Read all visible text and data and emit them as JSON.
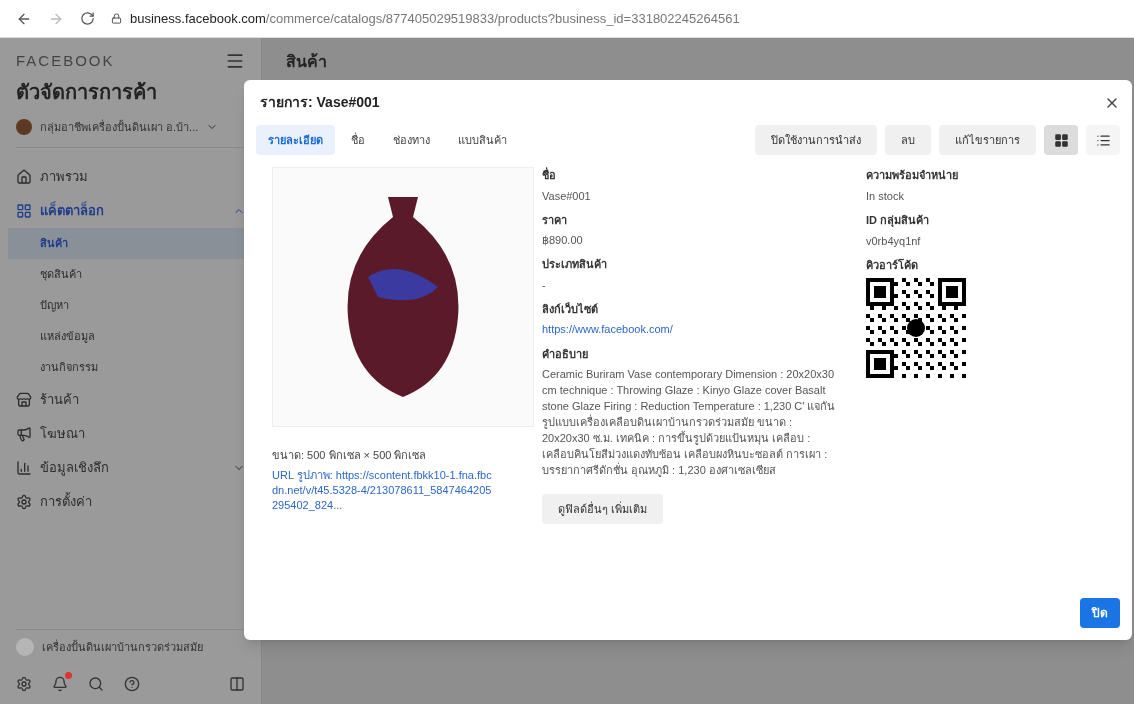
{
  "browser": {
    "url_domain": "business.facebook.com",
    "url_path": "/commerce/catalogs/877405029519833/products?business_id=331802245264561"
  },
  "sidebar": {
    "brand": "FACEBOOK",
    "title": "ตัวจัดการการค้า",
    "business": "กลุ่มอาชีพเครื่องปั้นดินเผา อ.บ้า...",
    "items": [
      {
        "kind": "home",
        "label": "ภาพรวม",
        "selected": false
      },
      {
        "kind": "catalog",
        "label": "แค็ตตาล็อก",
        "selected": true,
        "expanded": true,
        "children": [
          {
            "label": "สินค้า",
            "selected": true
          },
          {
            "label": "ชุดสินค้า",
            "selected": false
          },
          {
            "label": "ปัญหา",
            "selected": false
          },
          {
            "label": "แหล่งข้อมูล",
            "selected": false
          },
          {
            "label": "งานกิจกรรม",
            "selected": false
          }
        ]
      },
      {
        "kind": "shop",
        "label": "ร้านค้า",
        "selected": false
      },
      {
        "kind": "ads",
        "label": "โฆษณา",
        "selected": false
      },
      {
        "kind": "insights",
        "label": "ข้อมูลเชิงลึก",
        "selected": false,
        "expanded": false
      },
      {
        "kind": "settings",
        "label": "การตั้งค่า",
        "selected": false
      }
    ],
    "account": "เครื่องปั้นดินเผาบ้านกรวดร่วมสมัย"
  },
  "page": {
    "title": "สินค้า"
  },
  "modal": {
    "title": "รายการ: Vase#001",
    "tabs": [
      {
        "label": "รายละเอียด",
        "selected": true
      },
      {
        "label": "ชื่อ",
        "selected": false
      },
      {
        "label": "ช่องทาง",
        "selected": false
      },
      {
        "label": "แบบสินค้า",
        "selected": false
      }
    ],
    "actions": [
      "ปิดใช้งานการนำส่ง",
      "ลบ",
      "แก้ไขรายการ"
    ],
    "views": [
      {
        "kind": "grid",
        "selected": true
      },
      {
        "kind": "list",
        "selected": false
      }
    ],
    "image": {
      "size": "ขนาด: 500 พิกเซล × 500 พิกเซล",
      "url": "URL รูปภาพ: https://scontent.fbkk10-1.fna.fbcdn.net/v/t45.5328-4/213078611_5847464205295402_824..."
    },
    "fields": [
      {
        "kind": "text",
        "label": "ชื่อ",
        "value": "Vase#001"
      },
      {
        "kind": "text",
        "label": "ราคา",
        "value": "฿890.00"
      },
      {
        "kind": "text",
        "label": "ประเภทสินค้า",
        "value": "-"
      },
      {
        "kind": "link",
        "label": "ลิงก์เว็บไซต์",
        "value": "https://www.facebook.com/"
      },
      {
        "kind": "text",
        "label": "คำอธิบาย",
        "value": "Ceramic Buriram Vase contemporary Dimension : 20x20x30 cm technique : Throwing Glaze : Kinyo Glaze cover Basalt stone Glaze Firing : Reduction Temperature : 1,230 C' แจกันรูปแบบเครื่องเคลือบดินเผาบ้านกรวดร่วมสมัย ขนาด : 20x20x30 ซ.ม. เทคนิค : การขึ้นรูปด้วยแป้นหมุน เคลือบ : เคลือบคินโยสีม่วงแดงทับซ้อน เคลือบผงหินบะซอลต์ การเผา : บรรยากาศรีดักชั่น อุณหภูมิ : 1,230 องศาเซลเซียส"
      }
    ],
    "more_button": "ดูฟิลด์อื่นๆ เพิ่มเติม",
    "side_fields": [
      {
        "kind": "text",
        "label": "ความพร้อมจำหน่าย",
        "value": "In stock"
      },
      {
        "kind": "text",
        "label": "ID กลุ่มสินค้า",
        "value": "v0rb4yq1nf"
      },
      {
        "kind": "qr",
        "label": "คิวอาร์โค้ด"
      }
    ],
    "close_button": "ปิด"
  }
}
